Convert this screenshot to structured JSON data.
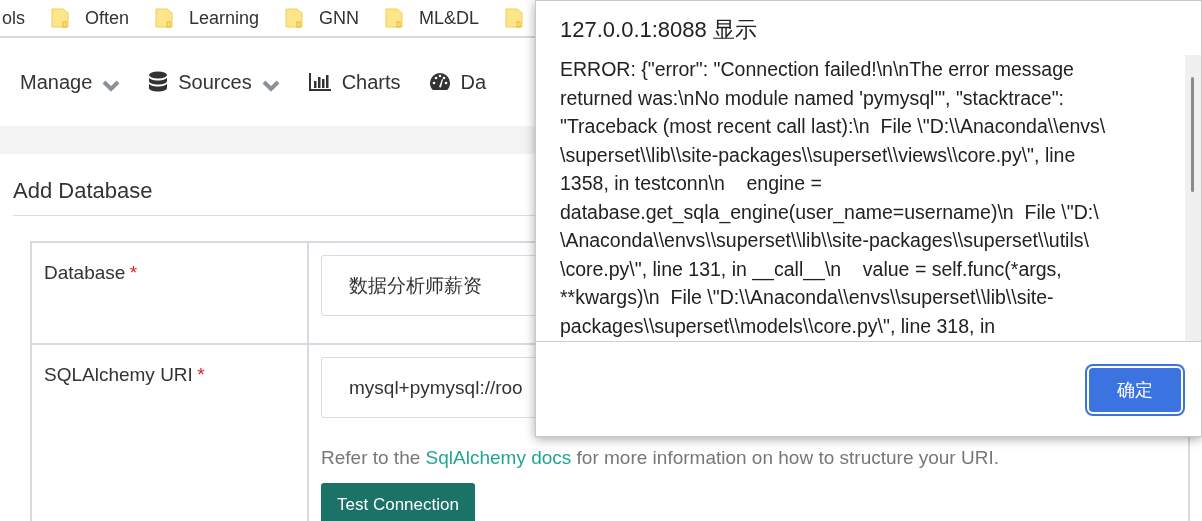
{
  "bookmarks": [
    {
      "label": "ols",
      "kind": "text"
    },
    {
      "label": "Often",
      "kind": "folder"
    },
    {
      "label": "Learning",
      "kind": "folder"
    },
    {
      "label": "GNN",
      "kind": "folder"
    },
    {
      "label": "ML&DL",
      "kind": "folder"
    },
    {
      "kind": "folder"
    }
  ],
  "nav": [
    {
      "label": "Manage",
      "kind": "dropdown"
    },
    {
      "label": "Sources",
      "kind": "dropdown"
    },
    {
      "label": "Charts",
      "kind": "link"
    },
    {
      "label": "Da",
      "kind": "link"
    }
  ],
  "page_title": "Add Database",
  "form": {
    "fields": [
      {
        "label": "Database",
        "required_mark": "*",
        "value": "数据分析师薪资"
      },
      {
        "label": "SQLAlchemy URI",
        "required_mark": "*",
        "value": "mysql+pymysql://roo",
        "help": [
          "Refer to the ",
          "SqlAlchemy docs",
          " for more information on how to structure your URI."
        ],
        "button": "Test Connection"
      }
    ]
  },
  "dialog": {
    "title": "127.0.0.1:8088 显示",
    "message_lines": [
      "ERROR: {\"error\": \"Connection failed!\\n\\nThe error message",
      "returned was:\\nNo module named 'pymysql'\", \"stacktrace\":",
      "\"Traceback (most recent call last):\\n  File \\\"D:\\\\Anaconda\\\\envs\\",
      "\\superset\\\\lib\\\\site-packages\\\\superset\\\\views\\\\core.py\\\", line",
      "1358, in testconn\\n    engine =",
      "database.get_sqla_engine(user_name=username)\\n  File \\\"D:\\",
      "\\Anaconda\\\\envs\\\\superset\\\\lib\\\\site-packages\\\\superset\\\\utils\\",
      "\\core.py\\\", line 131, in __call__\\n    value = self.func(*args,",
      "**kwargs)\\n  File \\\"D:\\\\Anaconda\\\\envs\\\\superset\\\\lib\\\\site-",
      "packages\\\\superset\\\\models\\\\core.py\\\", line 318, in"
    ],
    "ok_button": "确定"
  }
}
